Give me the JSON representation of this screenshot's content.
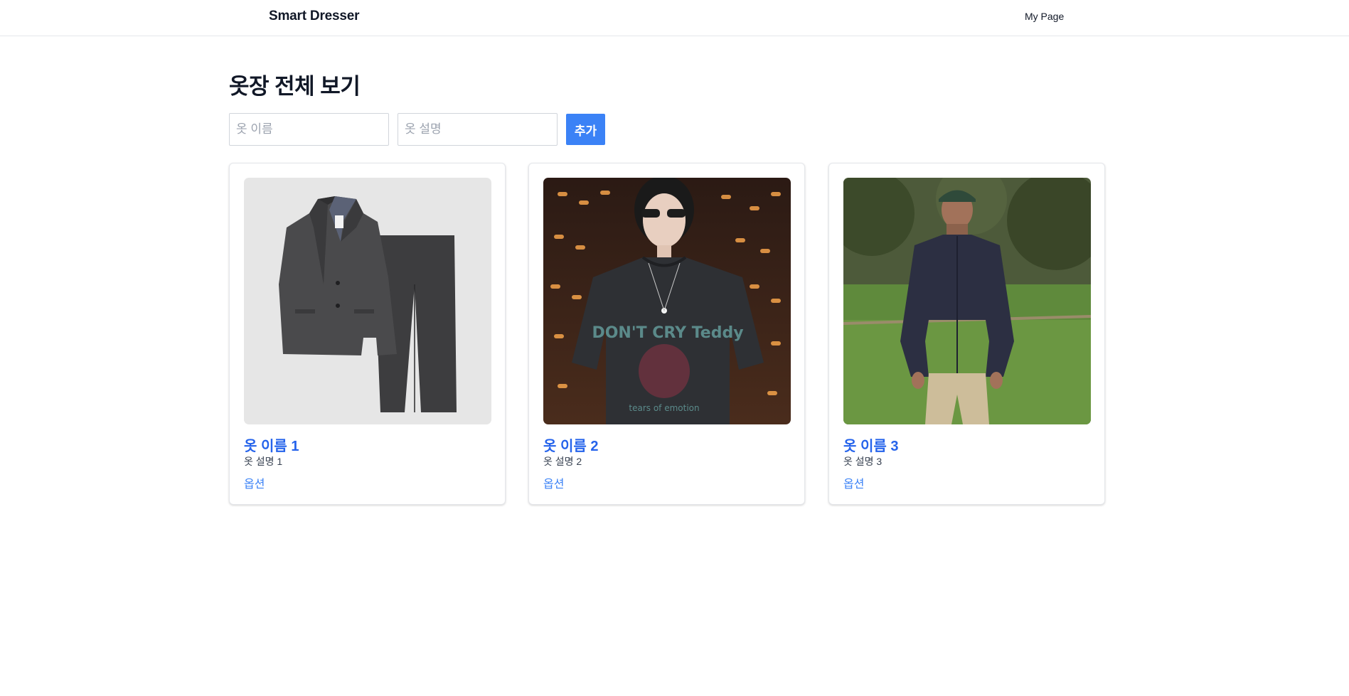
{
  "header": {
    "brand": "Smart Dresser",
    "nav_mypage": "My Page"
  },
  "page": {
    "title": "옷장 전체 보기"
  },
  "form": {
    "name_placeholder": "옷 이름",
    "desc_placeholder": "옷 설명",
    "add_label": "추가"
  },
  "colors": {
    "accent": "#3b82f6",
    "link": "#2563eb"
  },
  "cards": [
    {
      "title": "옷 이름 1",
      "description": "옷 설명 1",
      "option_label": "옵션",
      "image": "suit-photo"
    },
    {
      "title": "옷 이름 2",
      "description": "옷 설명 2",
      "option_label": "옵션",
      "image": "graphic-tee-photo"
    },
    {
      "title": "옷 이름 3",
      "description": "옷 설명 3",
      "option_label": "옵션",
      "image": "jacket-photo"
    }
  ]
}
